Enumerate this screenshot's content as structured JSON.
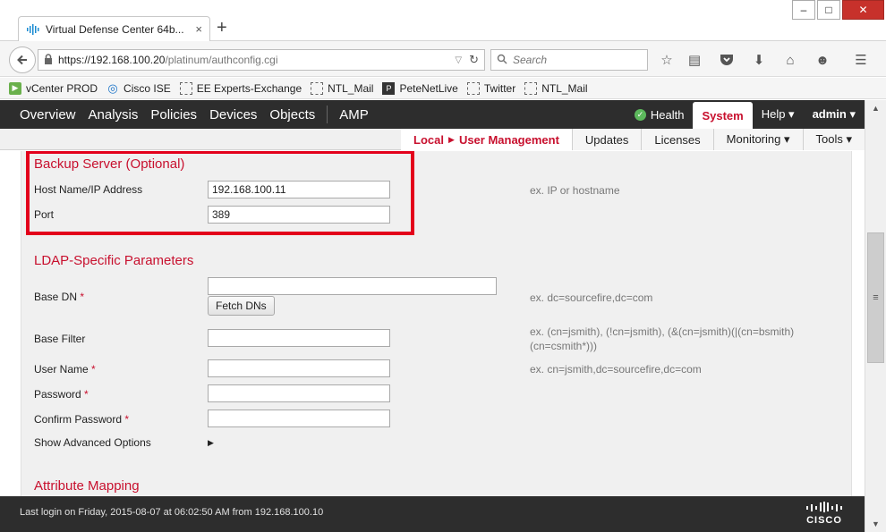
{
  "browser": {
    "tab_title": "Virtual Defense Center 64b...",
    "tab_favicon": "cisco",
    "tab_close": "×",
    "new_tab": "+",
    "url_host": "https://192.168.100.20",
    "url_path": "/platinum/authconfig.cgi",
    "search_placeholder": "Search",
    "win_min": "–",
    "win_max": "□",
    "win_close": "✕"
  },
  "bookmarks": [
    {
      "label": "vCenter PROD",
      "icon": "vcenter-icon"
    },
    {
      "label": "Cisco ISE",
      "icon": "cisco-ise-icon"
    },
    {
      "label": "EE Experts-Exchange",
      "icon": "blank-page-icon"
    },
    {
      "label": "NTL_Mail",
      "icon": "blank-page-icon"
    },
    {
      "label": "PeteNetLive",
      "icon": "petenetlive-icon"
    },
    {
      "label": "Twitter",
      "icon": "blank-page-icon"
    },
    {
      "label": "NTL_Mail",
      "icon": "blank-page-icon"
    }
  ],
  "appnav": {
    "items": [
      "Overview",
      "Analysis",
      "Policies",
      "Devices",
      "Objects"
    ],
    "amp": "AMP",
    "health": "Health",
    "system": "System",
    "help": "Help ▾",
    "user": "admin ▾"
  },
  "subnav": {
    "local": "Local",
    "user_management": "User Management",
    "items": [
      "Updates",
      "Licenses",
      "Monitoring ▾",
      "Tools ▾"
    ]
  },
  "form": {
    "backup_title": "Backup Server (Optional)",
    "host_label": "Host Name/IP Address",
    "host_value": "192.168.100.11",
    "host_hint": "ex. IP or hostname",
    "port_label": "Port",
    "port_value": "389",
    "ldap_title": "LDAP-Specific Parameters",
    "base_dn_label": "Base DN",
    "base_dn_hint": "ex. dc=sourcefire,dc=com",
    "fetch_button": "Fetch DNs",
    "base_filter_label": "Base Filter",
    "base_filter_hint": "ex. (cn=jsmith), (!cn=jsmith), (&(cn=jsmith)(|(cn=bsmith)(cn=csmith*)))",
    "user_name_label": "User Name",
    "user_name_hint": "ex. cn=jsmith,dc=sourcefire,dc=com",
    "password_label": "Password",
    "confirm_password_label": "Confirm Password",
    "required_mark": "*",
    "show_advanced_label": "Show Advanced Options",
    "attribute_title": "Attribute Mapping"
  },
  "footer": {
    "last_login": "Last login on Friday, 2015-08-07 at 06:02:50 AM from 192.168.100.10",
    "logo_text": "CISCO"
  },
  "colors": {
    "accent_red": "#c8102e",
    "highlight_red": "#e3001b",
    "nav_dark": "#2d2d2d"
  }
}
